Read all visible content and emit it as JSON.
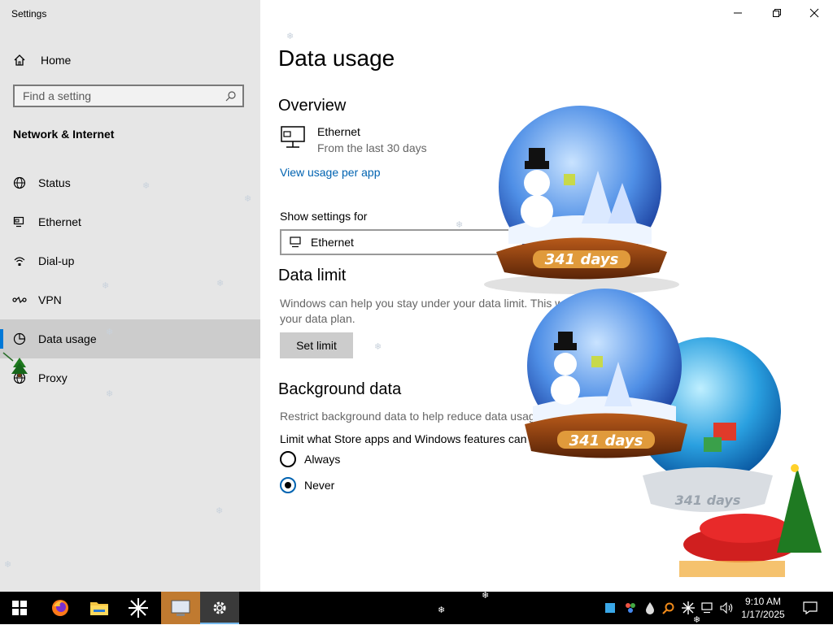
{
  "window": {
    "app_title": "Settings",
    "minimize_label": "—",
    "maximize_label": "□",
    "close_label": "✕"
  },
  "sidebar": {
    "home_label": "Home",
    "search_placeholder": "Find a setting",
    "section_title": "Network & Internet",
    "items": [
      {
        "label": "Status",
        "icon": "globe-icon"
      },
      {
        "label": "Ethernet",
        "icon": "ethernet-icon"
      },
      {
        "label": "Dial-up",
        "icon": "dialup-icon"
      },
      {
        "label": "VPN",
        "icon": "vpn-icon"
      },
      {
        "label": "Data usage",
        "icon": "data-usage-icon",
        "active": true
      },
      {
        "label": "Proxy",
        "icon": "proxy-icon"
      }
    ]
  },
  "main": {
    "title": "Data usage",
    "overview": {
      "heading": "Overview",
      "connection_name": "Ethernet",
      "period": "From the last 30 days",
      "view_usage_link": "View usage per app"
    },
    "show_settings": {
      "label": "Show settings for",
      "selected": "Ethernet"
    },
    "data_limit": {
      "heading": "Data limit",
      "description_line1": "Windows can help you stay under your data limit. This w",
      "description_line2": "your data plan.",
      "button": "Set limit"
    },
    "background_data": {
      "heading": "Background data",
      "description": "Restrict background data to help reduce data usage",
      "limit_label": "Limit what Store apps and Windows features can d",
      "options": [
        {
          "label": "Always",
          "selected": false
        },
        {
          "label": "Never",
          "selected": true
        }
      ]
    }
  },
  "desktop_overlay": {
    "globe_counter_1": "341 days",
    "globe_counter_2": "341 days",
    "globe_counter_3": "341 days"
  },
  "taskbar": {
    "time": "9:10 AM",
    "date": "1/17/2025"
  },
  "colors": {
    "accent": "#0078d7",
    "link": "#0063b1",
    "sidebar_bg": "#e6e6e6",
    "taskbar_bg": "#000000"
  }
}
